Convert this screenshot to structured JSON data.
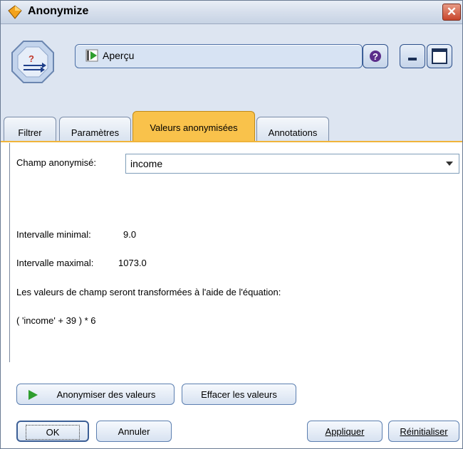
{
  "window": {
    "title": "Anonymize"
  },
  "toolbar": {
    "preview_label": "Aperçu"
  },
  "tabs": [
    {
      "label": "Filtrer"
    },
    {
      "label": "Paramètres"
    },
    {
      "label": "Valeurs anonymisées"
    },
    {
      "label": "Annotations"
    }
  ],
  "form": {
    "field_label": "Champ anonymisé:",
    "field_value": "income",
    "min_label": "Intervalle minimal:",
    "min_value": "9.0",
    "max_label": "Intervalle maximal:",
    "max_value": "1073.0",
    "info_text": "Les valeurs de champ seront transformées à l'aide de l'équation:",
    "equation": "( 'income' + 39 ) * 6"
  },
  "actions": {
    "anonymize_label": "Anonymiser des valeurs",
    "clear_label": "Effacer les valeurs"
  },
  "footer": {
    "ok_label": "OK",
    "cancel_label": "Annuler",
    "apply_label": "Appliquer",
    "reset_label": "Réinitialiser"
  },
  "colors": {
    "active_tab": "#f9c24b",
    "close_button": "#c8462c",
    "play_green": "#2e9e2e"
  }
}
